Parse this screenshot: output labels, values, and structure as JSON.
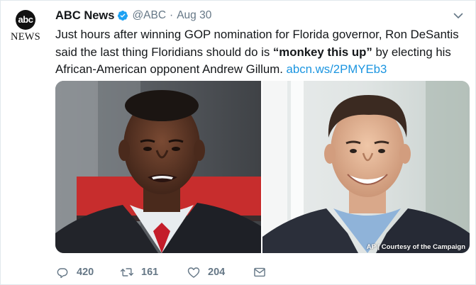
{
  "tweet": {
    "avatar": {
      "logo_text": "abc",
      "wordmark": "NEWS"
    },
    "author": {
      "display_name": "ABC News",
      "handle": "@ABC",
      "verified": true
    },
    "timestamp": "Aug 30",
    "text": {
      "part1": "Just hours after winning GOP nomination for Florida governor, Ron DeSantis said the last thing Floridians should do is ",
      "quote": "“monkey this up”",
      "part2": " by electing his African-American opponent Andrew Gillum. ",
      "link": "abcn.ws/2PMYEb3"
    },
    "media": {
      "credit": "AP | Courtesy of the Campaign"
    },
    "actions": {
      "replies": "420",
      "retweets": "161",
      "likes": "204"
    }
  },
  "colors": {
    "link": "#1b95e0",
    "secondary_text": "#657786",
    "verified": "#1da1f2",
    "border": "#e1e8ed"
  },
  "icons": [
    "verified-icon",
    "chevron-down-icon",
    "reply-icon",
    "retweet-icon",
    "like-icon",
    "dm-envelope-icon"
  ]
}
